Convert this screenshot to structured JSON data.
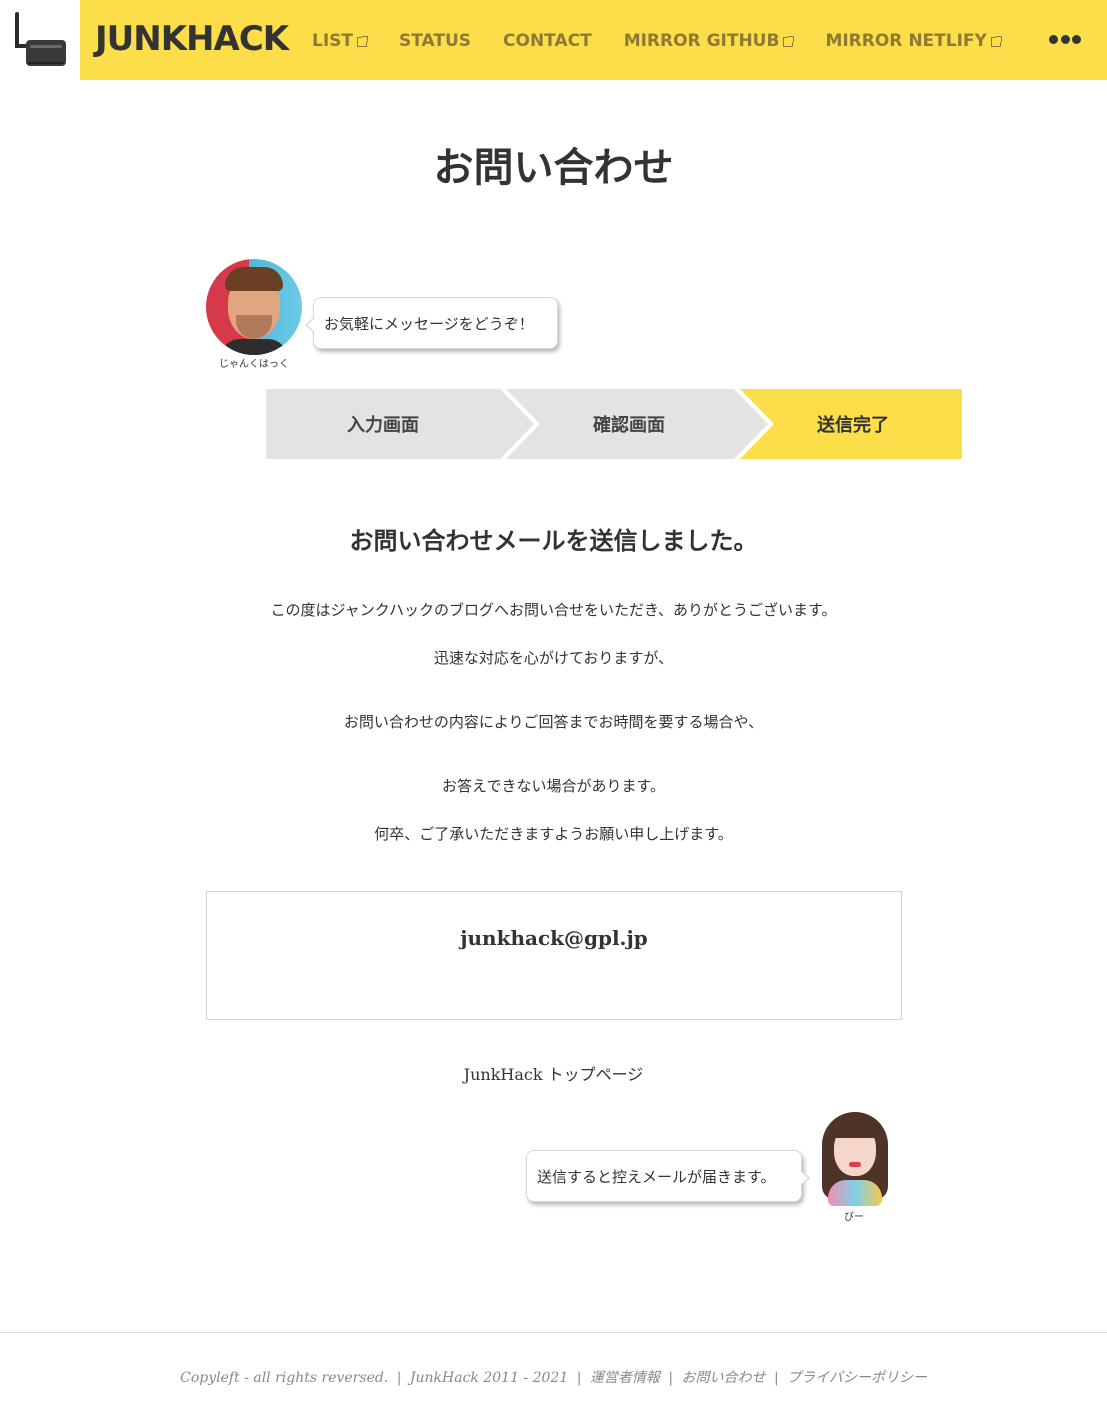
{
  "header": {
    "site_title": "JUNKHACK",
    "nav": [
      {
        "label": "LIST",
        "external": true
      },
      {
        "label": "STATUS",
        "external": false
      },
      {
        "label": "CONTACT",
        "external": false
      },
      {
        "label": "MIRROR GITHUB",
        "external": true
      },
      {
        "label": "MIRROR NETLIFY",
        "external": true
      }
    ],
    "more_icon": "more-dots-icon",
    "accent_color": "#fcdd4a"
  },
  "page": {
    "title": "お問い合わせ"
  },
  "speaker1": {
    "name": "じゃんくはっく",
    "message": "お気軽にメッセージをどうぞ！"
  },
  "steps": {
    "items": [
      "入力画面",
      "確認画面",
      "送信完了"
    ],
    "active_index": 2
  },
  "result": {
    "heading": "お問い合わせメールを送信しました。",
    "paragraphs": [
      "この度はジャンクハックのブログへお問い合せをいただき、ありがとうございます。",
      "迅速な対応を心がけておりますが、",
      "お問い合わせの内容によりご回答までお時間を要する場合や、",
      "お答えできない場合があります。",
      "何卒、ご了承いただきますようお願い申し上げます。"
    ]
  },
  "contact": {
    "email": "junkhack@gpl.jp"
  },
  "top_link": {
    "label": "JunkHack トップページ"
  },
  "speaker2": {
    "name": "ぴー",
    "message": "送信すると控えメールが届きます。"
  },
  "footer": {
    "copyleft": "Copyleft - all rights reversed.",
    "site": "JunkHack 2011 - 2021",
    "links": [
      "運営者情報",
      "お問い合わせ",
      "プライバシーポリシー"
    ],
    "separator": "|"
  }
}
